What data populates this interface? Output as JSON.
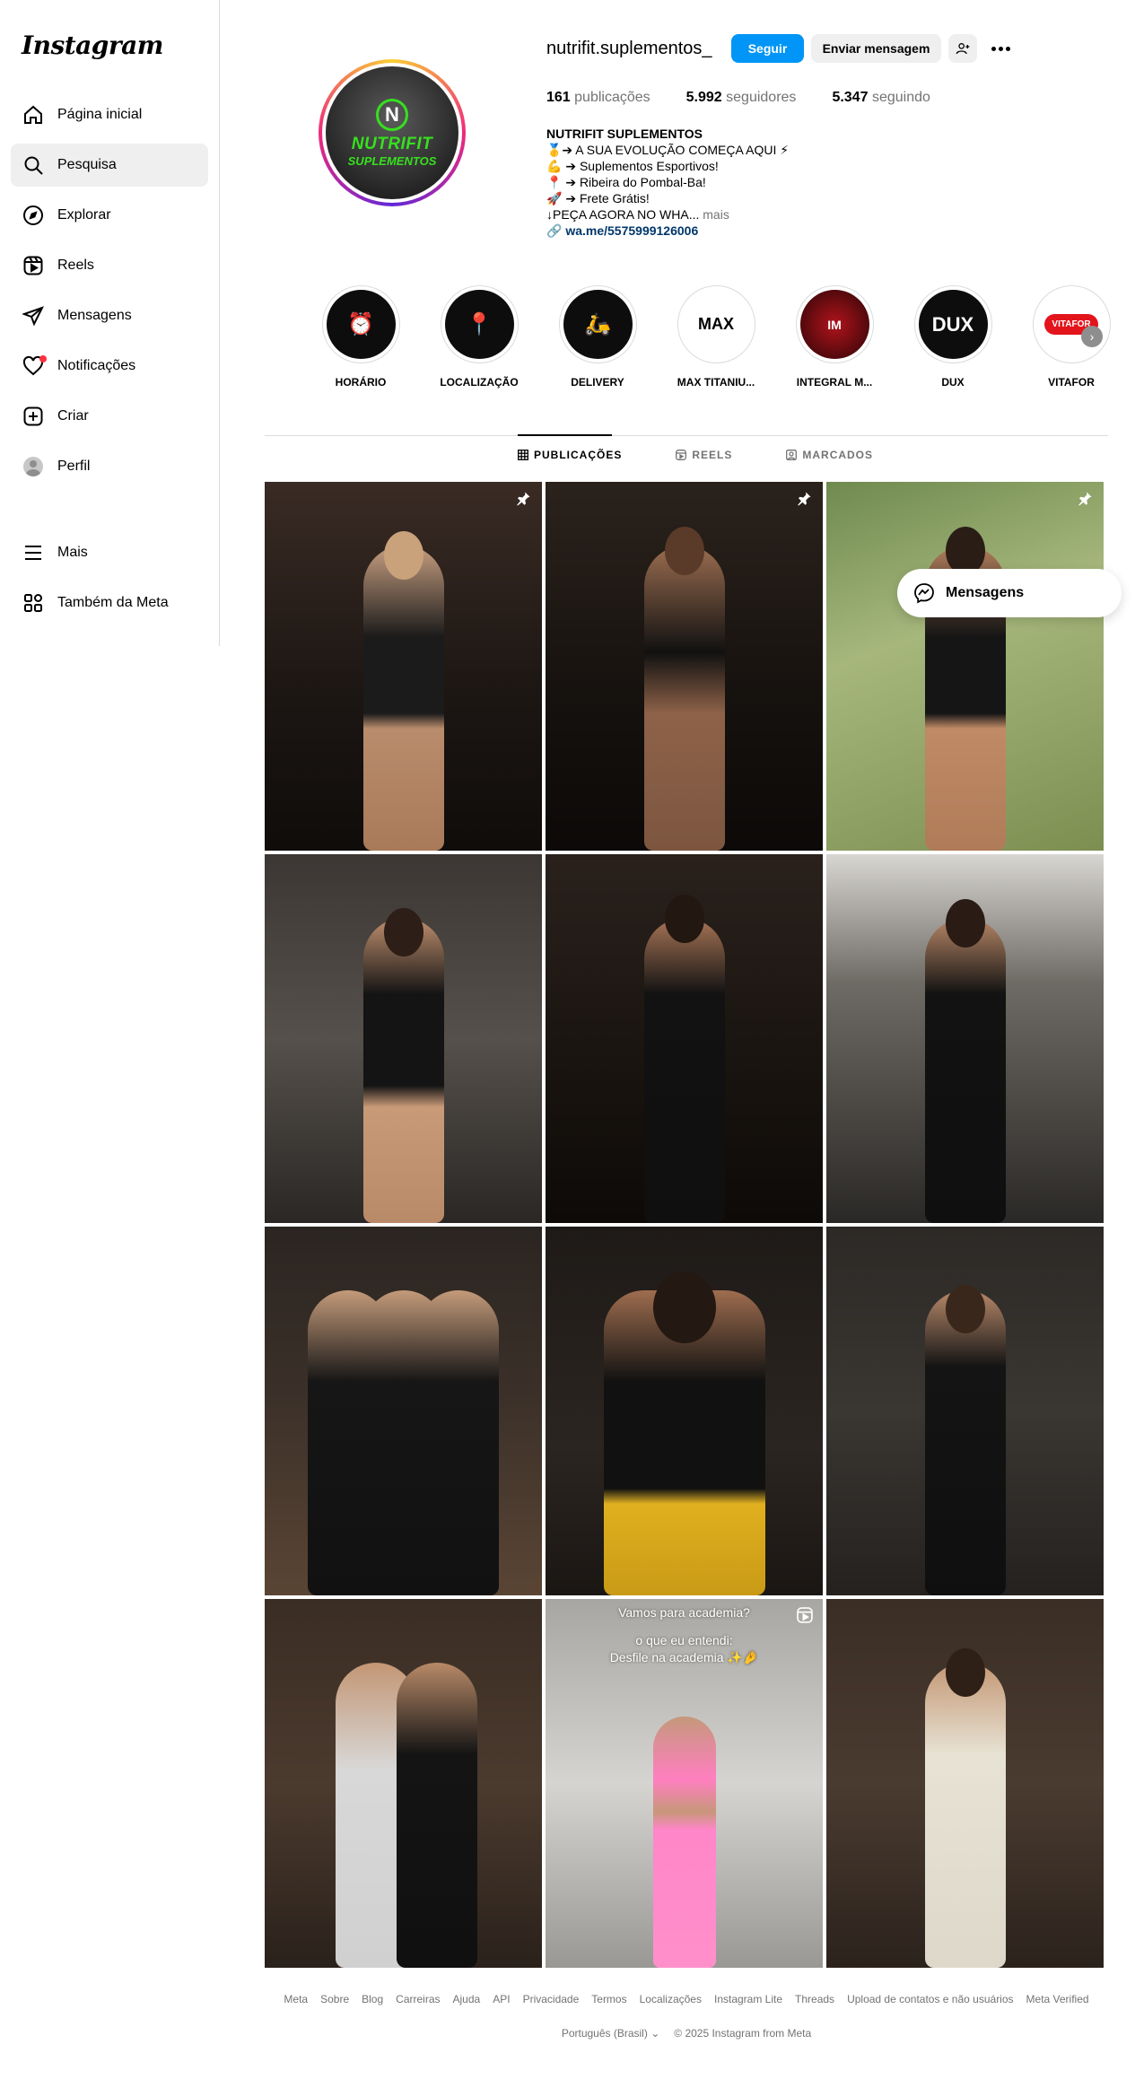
{
  "app": {
    "logo_text": "Instagram"
  },
  "sidebar": {
    "items": [
      {
        "label": "Página inicial",
        "icon": "home-icon"
      },
      {
        "label": "Pesquisa",
        "icon": "search-icon",
        "active": true
      },
      {
        "label": "Explorar",
        "icon": "compass-icon"
      },
      {
        "label": "Reels",
        "icon": "reels-icon"
      },
      {
        "label": "Mensagens",
        "icon": "send-icon"
      },
      {
        "label": "Notificações",
        "icon": "heart-icon",
        "badge": true
      },
      {
        "label": "Criar",
        "icon": "plus-square-icon"
      },
      {
        "label": "Perfil",
        "icon": "avatar"
      }
    ],
    "bottom": [
      {
        "label": "Mais",
        "icon": "menu-icon"
      },
      {
        "label": "Também da Meta",
        "icon": "meta-apps-icon"
      }
    ]
  },
  "profile": {
    "username": "nutrifit.suplementos_",
    "follow_label": "Seguir",
    "message_label": "Enviar mensagem",
    "avatar_brand_line1": "NUTRIFIT",
    "avatar_brand_line2": "SUPLEMENTOS",
    "avatar_letter": "N",
    "stats": {
      "posts_count": "161",
      "posts_label": "publicações",
      "followers_count": "5.992",
      "followers_label": "seguidores",
      "following_count": "5.347",
      "following_label": "seguindo"
    },
    "bio": {
      "name": "NUTRIFIT SUPLEMENTOS",
      "line1": "🥇➔ A SUA EVOLUÇÃO COMEÇA AQUI ⚡",
      "line2": "💪 ➔ Suplementos Esportivos!",
      "line3": "📍 ➔ Ribeira do Pombal-Ba!",
      "line4": "🚀 ➔ Frete Grátis!",
      "line5": "↓PEÇA AGORA NO WHA...",
      "more": "mais",
      "link": "wa.me/5575999126006"
    }
  },
  "highlights": [
    {
      "label": "HORÁRIO",
      "inner": "⏰"
    },
    {
      "label": "LOCALIZAÇÃO",
      "inner": "📍"
    },
    {
      "label": "DELIVERY",
      "inner": "🛵"
    },
    {
      "label": "MAX TITANIU...",
      "inner": "MAX"
    },
    {
      "label": "INTEGRAL M...",
      "inner": "IM"
    },
    {
      "label": "DUX",
      "inner": "DUX"
    },
    {
      "label": "VITAFOR",
      "inner": "VITAFOR"
    }
  ],
  "tabs": [
    {
      "label": "PUBLICAÇÕES",
      "active": true
    },
    {
      "label": "REELS"
    },
    {
      "label": "MARCADOS"
    }
  ],
  "posts": [
    {
      "pinned": true
    },
    {
      "pinned": true
    },
    {
      "pinned": true
    },
    {},
    {},
    {},
    {},
    {},
    {},
    {},
    {
      "reel": true,
      "caption_line1": "Vamos para academia?",
      "caption_line2": "o que eu entendi:",
      "caption_line3": "Desfile na academia ✨🤌"
    },
    {}
  ],
  "messages_float": {
    "label": "Mensagens"
  },
  "colors": {
    "accent": "#0095f6",
    "brand_green": "#36e01e",
    "muted": "#737373"
  },
  "footer": {
    "links": [
      "Meta",
      "Sobre",
      "Blog",
      "Carreiras",
      "Ajuda",
      "API",
      "Privacidade",
      "Termos",
      "Localizações",
      "Instagram Lite",
      "Threads",
      "Upload de contatos e não usuários",
      "Meta Verified"
    ],
    "language": "Português (Brasil)",
    "copyright": "© 2025 Instagram from Meta"
  }
}
